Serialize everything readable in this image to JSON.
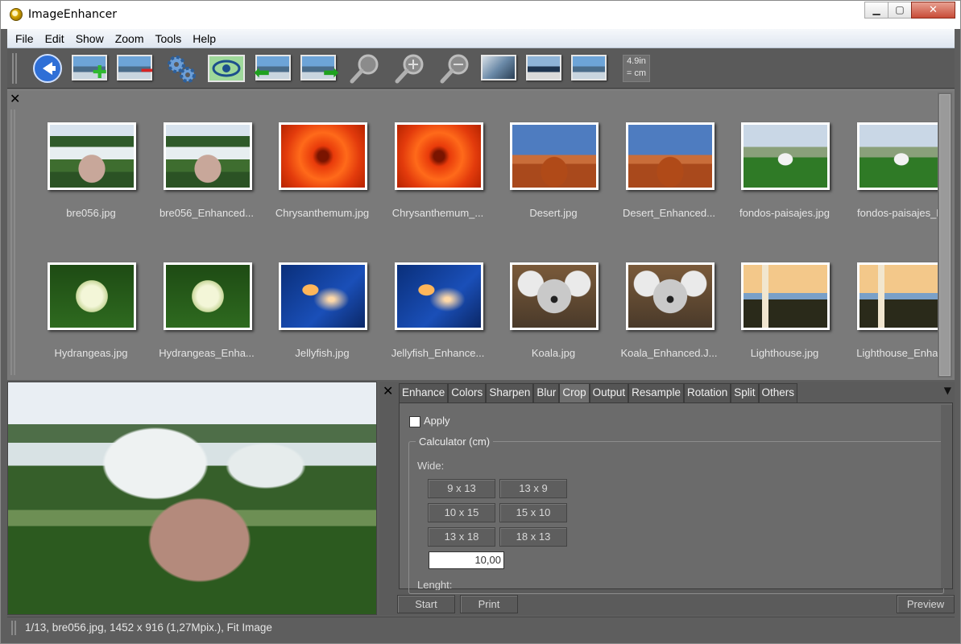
{
  "window": {
    "title": "ImageEnhancer"
  },
  "menu": [
    "File",
    "Edit",
    "Show",
    "Zoom",
    "Tools",
    "Help"
  ],
  "toolbar": {
    "icons": [
      "back-icon",
      "add-image-icon",
      "remove-image-icon",
      "settings-gears-icon",
      "eye-view-icon",
      "previous-image-icon",
      "next-image-icon",
      "zoom-icon",
      "zoom-in-icon",
      "zoom-out-icon",
      "fit-image-icon",
      "actual-size-icon",
      "resize-image-icon"
    ],
    "unit_line1": "4.9in",
    "unit_line2": "= cm"
  },
  "thumbnails": [
    {
      "name": "bre056.jpg",
      "theme": "water"
    },
    {
      "name": "bre056_Enhanced...",
      "theme": "water"
    },
    {
      "name": "Chrysanthemum.jpg",
      "theme": "flower"
    },
    {
      "name": "Chrysanthemum_...",
      "theme": "flower"
    },
    {
      "name": "Desert.jpg",
      "theme": "desert"
    },
    {
      "name": "Desert_Enhanced...",
      "theme": "desert"
    },
    {
      "name": "fondos-paisajes.jpg",
      "theme": "mountain"
    },
    {
      "name": "fondos-paisajes_E",
      "theme": "mountain"
    },
    {
      "name": "Hydrangeas.jpg",
      "theme": "hydra"
    },
    {
      "name": "Hydrangeas_Enha...",
      "theme": "hydra"
    },
    {
      "name": "Jellyfish.jpg",
      "theme": "jelly"
    },
    {
      "name": "Jellyfish_Enhance...",
      "theme": "jelly"
    },
    {
      "name": "Koala.jpg",
      "theme": "koala"
    },
    {
      "name": "Koala_Enhanced.J...",
      "theme": "koala"
    },
    {
      "name": "Lighthouse.jpg",
      "theme": "light"
    },
    {
      "name": "Lighthouse_Enhan",
      "theme": "light"
    }
  ],
  "tabs": [
    "Enhance",
    "Colors",
    "Sharpen",
    "Blur",
    "Crop",
    "Output",
    "Resample",
    "Rotation",
    "Split",
    "Others"
  ],
  "active_tab": "Crop",
  "crop": {
    "apply_label": "Apply",
    "calculator_title": "Calculator (cm)",
    "wide_label": "Wide:",
    "sizes": [
      "9 x 13",
      "13 x 9",
      "10 x 15",
      "15 x 10",
      "13 x 18",
      "18 x 13"
    ],
    "wide_value": "10,00",
    "length_label": "Lenght:"
  },
  "buttons": {
    "start": "Start",
    "print": "Print",
    "preview": "Preview"
  },
  "status": "1/13, bre056.jpg, 1452 x 916 (1,27Mpix.), Fit Image"
}
